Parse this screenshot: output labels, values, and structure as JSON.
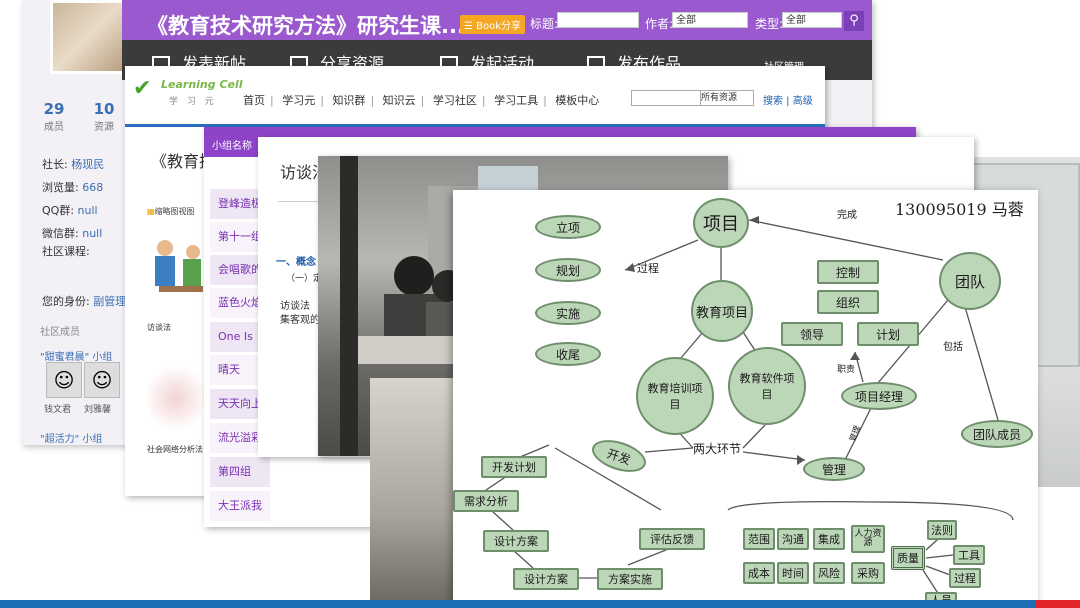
{
  "forum": {
    "title": "《教育技术研究方法》研究生课...",
    "share_label": "分享",
    "share_prefix": "☰ Book",
    "title_label": "标题:",
    "author_label": "作者:",
    "author_value": "全部",
    "type_label": "类型:",
    "type_value": "全部",
    "nav": [
      "发表新帖",
      "分享资源",
      "发起活动",
      "发布作品"
    ],
    "manage_label": "社区管理",
    "stats": [
      {
        "value": "29",
        "label": "成员"
      },
      {
        "value": "10",
        "label": "资源"
      }
    ],
    "info": [
      {
        "label": "社长:",
        "value": "杨现民"
      },
      {
        "label": "浏览量:",
        "value": "668"
      },
      {
        "label": "QQ群:",
        "value": "null"
      },
      {
        "label": "微信群:",
        "value": "null"
      },
      {
        "label": "社区课程:",
        "value": ""
      }
    ],
    "identity_label": "您的身份:",
    "identity_value": "副管理",
    "members_section": "社区成员",
    "group1": "\"甜蜜君晨\" 小组",
    "group2": "\"超活力\" 小组",
    "members": [
      "钱文君",
      "刘雅馨"
    ]
  },
  "lc": {
    "brand": "Learning Cell",
    "brand_cn": "学 习 元",
    "nav": [
      "首页",
      "学习元",
      "知识群",
      "知识云",
      "学习社区",
      "学习工具",
      "模板中心"
    ],
    "search_scope": "所有资源",
    "search_link": "搜索",
    "advanced_link": "高级",
    "big_title": "《教育技",
    "mindmap_label": "缩略图视图",
    "caption1": "访谈法",
    "caption2": "社会网络分析法"
  },
  "groups": {
    "header": "小组名称",
    "items": [
      "登峰造极",
      "第十一组",
      "会唱歌的",
      "蓝色火焰",
      "One Is",
      "晴天",
      "天天向上",
      "流光溢彩",
      "第四组",
      "大王派我"
    ]
  },
  "doc": {
    "title": "访谈法",
    "concept": "一、概念",
    "sub": "（一）定",
    "line1": "访谈法",
    "line2": "集客观的"
  },
  "map": {
    "author": "130095019  马蓉",
    "nodes": {
      "project": "项目",
      "edu_project": "教育项目",
      "training": "教育培训项目",
      "software": "教育软件项目",
      "team": "团队",
      "manager": "项目经理",
      "members": "团队成员",
      "management": "管理",
      "develop": "开发",
      "setup": "立项",
      "plan": "规划",
      "implement": "实施",
      "close": "收尾",
      "control": "控制",
      "organize": "组织",
      "lead": "领导",
      "plan2": "计划",
      "dev_plan": "开发计划",
      "req": "需求分析",
      "design1": "设计方案",
      "design2": "设计方案",
      "impl": "方案实施",
      "eval": "评估反馈",
      "scope": "范围",
      "comm": "沟通",
      "integrate": "集成",
      "hr": "人力资源",
      "cost": "成本",
      "time": "时间",
      "risk": "风险",
      "purchase": "采购",
      "quality": "质量",
      "rules": "法则",
      "tools": "工具",
      "process": "过程",
      "people": "人员"
    },
    "labels": {
      "process": "过程",
      "complete": "完成",
      "include": "包括",
      "duty": "职责",
      "two_links": "两大环节",
      "mgmt_tag": "管理"
    }
  }
}
